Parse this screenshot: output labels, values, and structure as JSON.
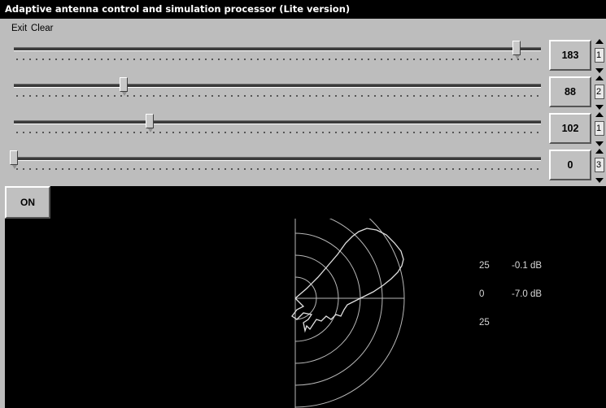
{
  "window": {
    "title": "Adaptive antenna control and simulation processor (Lite version)"
  },
  "menu": {
    "exit": "Exit",
    "clear": "Clear"
  },
  "sliders": [
    {
      "value": "183",
      "position_fraction": 0.96,
      "spinner": "1"
    },
    {
      "value": "88",
      "position_fraction": 0.21,
      "spinner": "2"
    },
    {
      "value": "102",
      "position_fraction": 0.26,
      "spinner": "1"
    },
    {
      "value": "0",
      "position_fraction": 0.0,
      "spinner": "3"
    }
  ],
  "on_button": {
    "label": "ON"
  },
  "readouts": {
    "row1_angle": "25",
    "row1_db": "-0.1 dB",
    "row2_angle": "0",
    "row2_db": "-7.0 dB",
    "row3_angle": "25"
  },
  "colors": {
    "panel": "#bdbdbd",
    "display_bg": "#000000",
    "grid": "#b8b8b8",
    "pattern": "#e0e0e0"
  }
}
